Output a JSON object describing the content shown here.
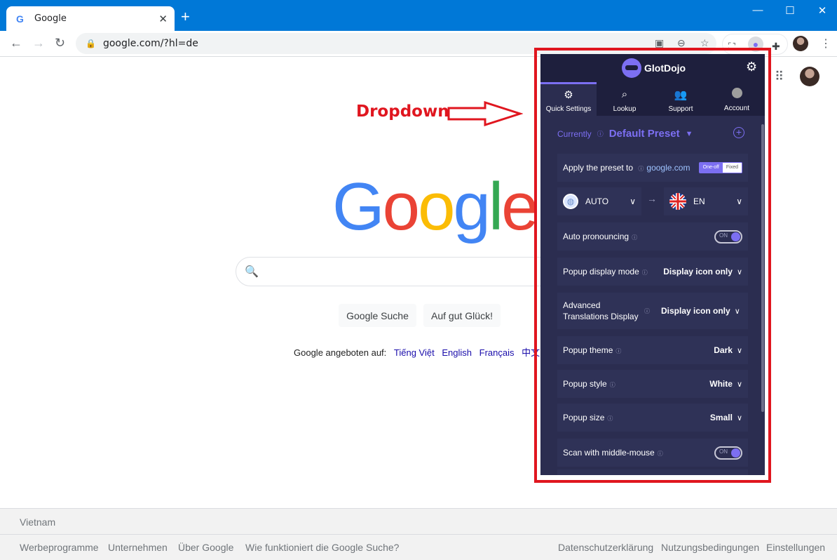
{
  "browser": {
    "tab_title": "Google",
    "tab_favicon": "G",
    "url": "google.com/?hl=de",
    "new_tab_symbol": "+",
    "window_controls": {
      "minimize": "—",
      "maximize": "☐",
      "close": "✕"
    }
  },
  "google": {
    "logo_letters": [
      "G",
      "o",
      "o",
      "g",
      "l",
      "e"
    ],
    "logo_colors": [
      "#4285f4",
      "#ea4335",
      "#fbbc05",
      "#4285f4",
      "#34a853",
      "#ea4335"
    ],
    "search_button": "Google Suche",
    "lucky_button": "Auf gut Glück!",
    "offered_in_label": "Google angeboten auf:",
    "languages": [
      "Tiếng Việt",
      "English",
      "Français",
      "中文（繁體）"
    ],
    "footer_country": "Vietnam",
    "footer_left_links": [
      "Werbeprogramme",
      "Unternehmen",
      "Über Google",
      "Wie funktioniert die Google Suche?"
    ],
    "footer_right_links": [
      "Datenschutzerklärung",
      "Nutzungsbedingungen",
      "Einstellungen"
    ]
  },
  "annotation": {
    "label": "Dropdown",
    "color": "#e0161f"
  },
  "extension": {
    "brand": "GlotDojo",
    "accent": "#7c6ff2",
    "tabs": [
      {
        "label": "Quick Settings",
        "icon": "gear-icon"
      },
      {
        "label": "Lookup",
        "icon": "search-icon"
      },
      {
        "label": "Support",
        "icon": "people-icon"
      },
      {
        "label": "Account",
        "icon": "account-icon"
      }
    ],
    "currently_label": "Currently",
    "preset_name": "Default Preset",
    "apply_label": "Apply the preset to",
    "apply_site": "google.com",
    "toggle_oneoff": "One-off",
    "toggle_fixed": "Fixed",
    "source_lang": "AUTO",
    "target_lang": "EN",
    "toggle_on_text": "ON",
    "settings": [
      {
        "label": "Auto pronouncing",
        "value": ""
      },
      {
        "label": "Popup display mode",
        "value": "Display icon only"
      },
      {
        "label": "Advanced Translations Display",
        "value": "Display icon only"
      },
      {
        "label": "Popup theme",
        "value": "Dark"
      },
      {
        "label": "Popup style",
        "value": "White"
      },
      {
        "label": "Popup size",
        "value": "Small"
      },
      {
        "label": "Scan with middle-mouse",
        "value": ""
      }
    ]
  }
}
